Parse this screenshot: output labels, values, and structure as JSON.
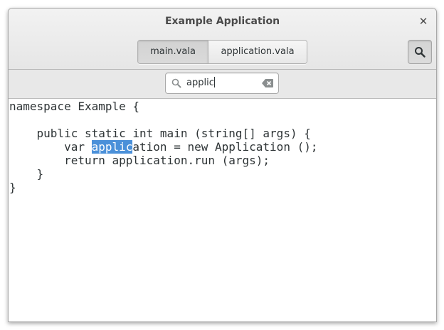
{
  "window": {
    "title": "Example Application"
  },
  "tabs": [
    {
      "label": "main.vala",
      "active": true
    },
    {
      "label": "application.vala",
      "active": false
    }
  ],
  "search": {
    "value": "applic"
  },
  "code": {
    "lines": [
      "namespace Example {",
      "",
      "    public static int main (string[] args) {",
      "        var ",
      "        return application.run (args);",
      "    }",
      "}"
    ],
    "match_line": {
      "prefix": "        var ",
      "match": "applic",
      "suffix": "ation = new Application ();"
    }
  },
  "colors": {
    "selection": "#4a90d9",
    "text": "#2e3436"
  }
}
